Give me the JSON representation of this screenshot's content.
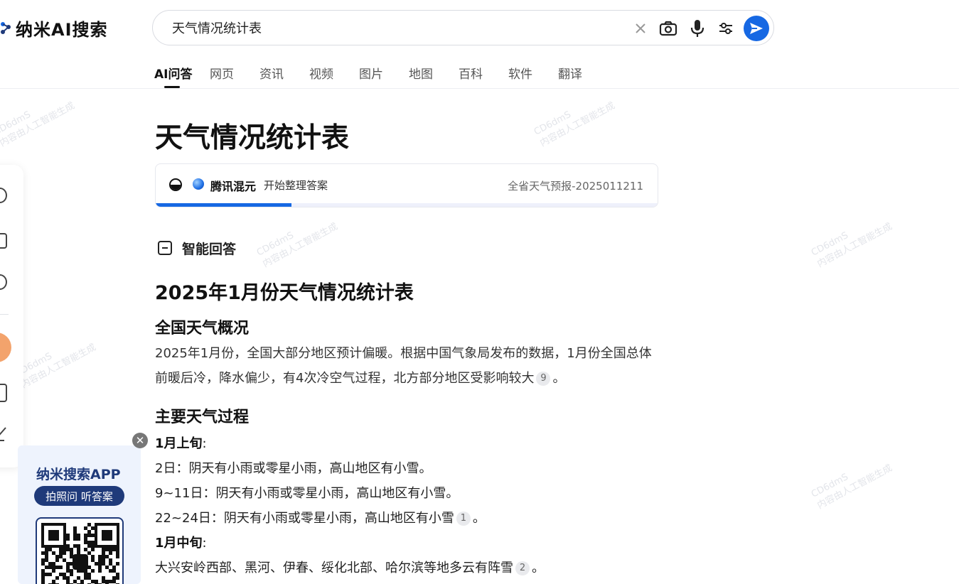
{
  "brand": {
    "name": "纳米AI搜索"
  },
  "search": {
    "query": "天气情况统计表"
  },
  "tabs": [
    {
      "label": "AI问答"
    },
    {
      "label": "网页"
    },
    {
      "label": "资讯"
    },
    {
      "label": "视频"
    },
    {
      "label": "图片"
    },
    {
      "label": "地图"
    },
    {
      "label": "百科"
    },
    {
      "label": "软件"
    },
    {
      "label": "翻译"
    }
  ],
  "watermark": {
    "line1": "CD6dmS",
    "line2": "内容由人工智能生成"
  },
  "promo": {
    "title": "纳米搜索APP",
    "subtitle": "拍照问 听答案"
  },
  "main": {
    "title": "天气情况统计表",
    "status": {
      "model": "腾讯混元",
      "text": "开始整理答案",
      "source": "全省天气预报-2025011211",
      "progress": 0.27
    },
    "section_label": "智能回答",
    "heading": "2025年1月份天气情况统计表",
    "overview": {
      "title": "全国天气概况",
      "text": "2025年1月份，全国大部分地区预计偏暖。根据中国气象局发布的数据，1月份全国总体前暖后冷，降水偏少，有4次冷空气过程，北方部分地区受影响较大",
      "cite": "9",
      "end": "。"
    },
    "process": {
      "title": "主要天气过程",
      "early_label": "1月上旬",
      "colon": ":",
      "line1": "2日：阴天有小雨或零星小雨，高山地区有小雪。",
      "line2": "9~11日：阴天有小雨或零星小雨，高山地区有小雪。",
      "line3": "22~24日：阴天有小雨或零星小雨，高山地区有小雪",
      "line3_cite": "1",
      "line3_end": "。",
      "mid_label": "1月中旬",
      "line4": "大兴安岭西部、黑河、伊春、绥化北部、哈尔滨等地多云有阵雪",
      "line4_cite": "2",
      "line4_end": "。"
    }
  },
  "colors": {
    "accent": "#1668e3",
    "promo_navy": "#1f3a7a"
  }
}
